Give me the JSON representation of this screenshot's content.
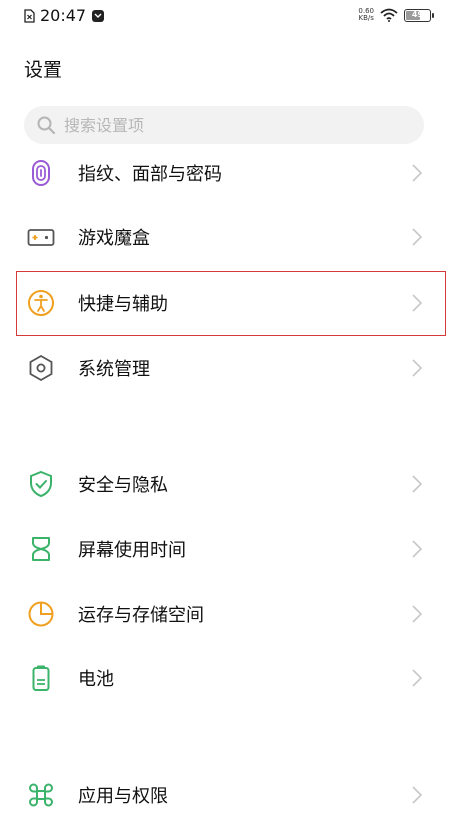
{
  "status_bar": {
    "time": "20:47",
    "net_speed_value": "0.60",
    "net_speed_unit": "KB/s",
    "battery_level": "49"
  },
  "page": {
    "title": "设置"
  },
  "search": {
    "placeholder": "搜索设置项"
  },
  "settings_items": [
    {
      "label": "指纹、面部与密码",
      "icon": "fingerprint-icon"
    },
    {
      "label": "游戏魔盒",
      "icon": "gamepad-icon"
    },
    {
      "label": "快捷与辅助",
      "icon": "accessibility-icon"
    },
    {
      "label": "系统管理",
      "icon": "hexagon-settings-icon"
    },
    {
      "label": "安全与隐私",
      "icon": "shield-check-icon"
    },
    {
      "label": "屏幕使用时间",
      "icon": "hourglass-icon"
    },
    {
      "label": "运存与存储空间",
      "icon": "pie-chart-icon"
    },
    {
      "label": "电池",
      "icon": "battery-icon"
    },
    {
      "label": "应用与权限",
      "icon": "command-icon"
    }
  ],
  "colors": {
    "accent_green": "#3bb36a",
    "accent_orange": "#f0a020",
    "highlight_red": "#d43a3a"
  }
}
